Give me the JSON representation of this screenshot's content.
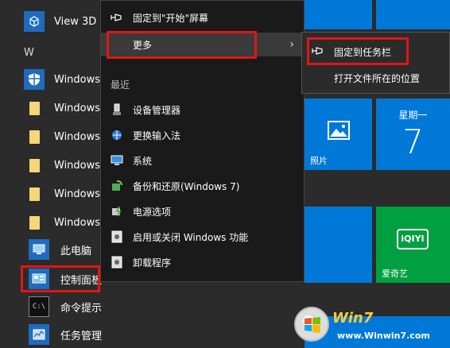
{
  "applist": {
    "items": [
      {
        "label": "View 3D"
      },
      {
        "label": "Windows"
      },
      {
        "label": "Windows"
      },
      {
        "label": "Windows"
      },
      {
        "label": "Windows"
      },
      {
        "label": "Windows"
      },
      {
        "label": "Windows"
      },
      {
        "label": "此电脑"
      },
      {
        "label": "控制面板"
      },
      {
        "label": "命令提示符"
      },
      {
        "label": "任务管理器"
      }
    ],
    "letter_header": "W"
  },
  "context_menu": {
    "pin_start": "固定到\"开始\"屏幕",
    "more": "更多",
    "recent_header": "最近",
    "recent_items": [
      {
        "label": "设备管理器"
      },
      {
        "label": "更换输入法"
      },
      {
        "label": "系统"
      },
      {
        "label": "备份和还原(Windows 7)"
      },
      {
        "label": "电源选项"
      },
      {
        "label": "启用或关闭 Windows 功能"
      },
      {
        "label": "卸载程序"
      }
    ]
  },
  "submenu": {
    "pin_taskbar": "固定到任务栏",
    "open_location": "打开文件所在的位置"
  },
  "tiles": {
    "photos_label": "照片",
    "calendar_weekday": "星期一",
    "calendar_day": "7",
    "iqiyi_label": "爱奇艺",
    "iqiyi_logo": "iQIYI"
  },
  "watermark": {
    "brand": "Win7",
    "url": "www.Winwin7.com"
  },
  "colors": {
    "accent_blue": "#0078d7",
    "green": "#00a040",
    "highlight_red": "#e01616"
  }
}
